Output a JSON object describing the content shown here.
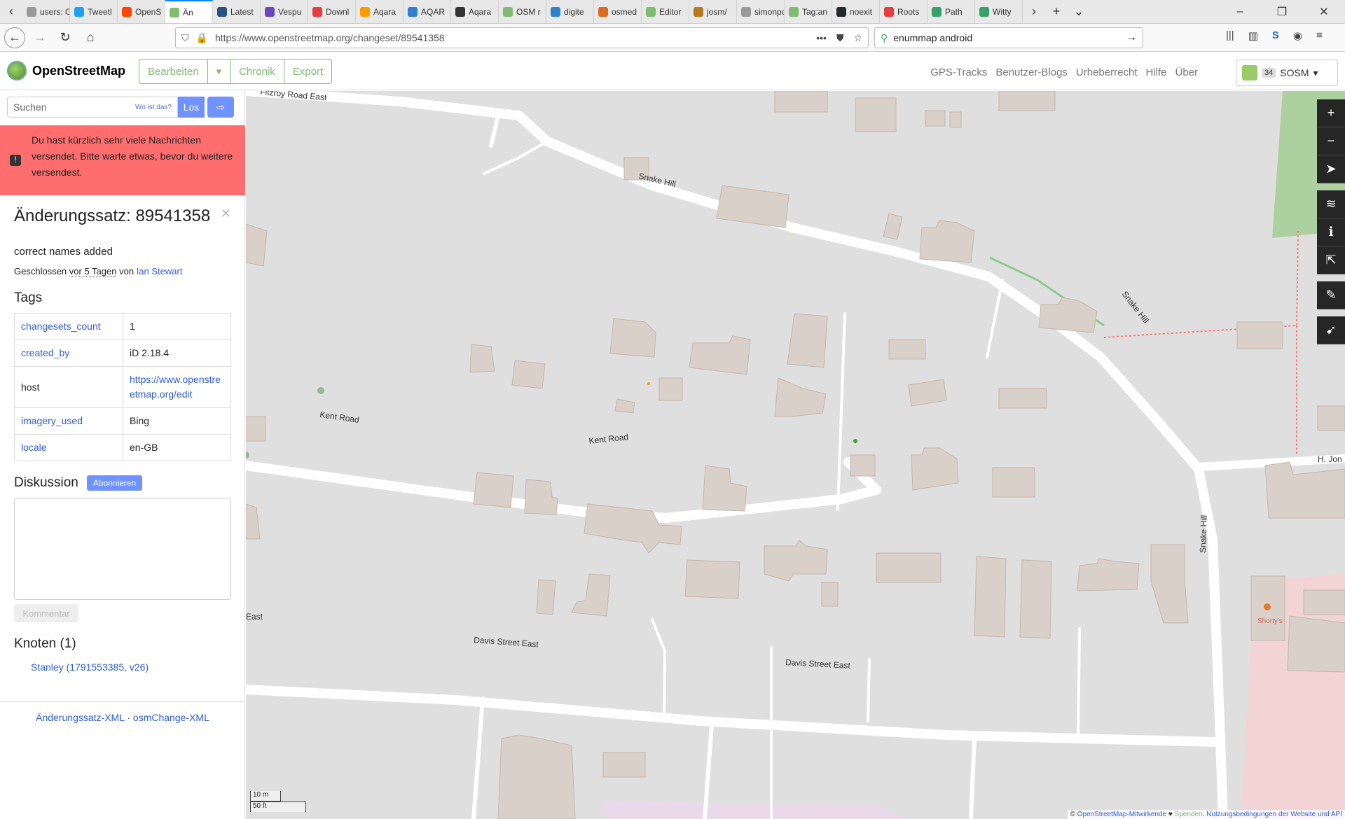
{
  "browser": {
    "tabs": [
      {
        "label": "users: Gern",
        "color": "#999"
      },
      {
        "label": "Tweetl",
        "color": "#1da1f2"
      },
      {
        "label": "OpenS",
        "color": "#ff4500"
      },
      {
        "label": "Än",
        "color": "#7ebc6f"
      },
      {
        "label": "Latest",
        "color": "#2c5282"
      },
      {
        "label": "Vespu",
        "color": "#6b46c1"
      },
      {
        "label": "Downl",
        "color": "#e53e3e"
      },
      {
        "label": "Aqara",
        "color": "#ff9900"
      },
      {
        "label": "AQAR",
        "color": "#3182ce"
      },
      {
        "label": "Aqara",
        "color": "#333"
      },
      {
        "label": "OSM r",
        "color": "#7ebc6f"
      },
      {
        "label": "digite",
        "color": "#3182ce"
      },
      {
        "label": "osmed",
        "color": "#dd6b20"
      },
      {
        "label": "Editor",
        "color": "#7ebc6f"
      },
      {
        "label": "josm/",
        "color": "#b7791f"
      },
      {
        "label": "simonpoo",
        "color": "#999"
      },
      {
        "label": "Tag:an",
        "color": "#7ebc6f"
      },
      {
        "label": "noexit",
        "color": "#24292e"
      },
      {
        "label": "Roots",
        "color": "#e53e3e"
      },
      {
        "label": "Path",
        "color": "#38a169"
      },
      {
        "label": "Witty",
        "color": "#38a169"
      }
    ],
    "url": "https://www.openstreetmap.org/changeset/89541358",
    "search_value": "enummap android"
  },
  "header": {
    "brand": "OpenStreetMap",
    "edit_label": "Bearbeiten",
    "edit_dropdown": "▾",
    "history_label": "Chronik",
    "export_label": "Export",
    "nav": [
      "GPS-Tracks",
      "Benutzer-Blogs",
      "Urheberrecht",
      "Hilfe",
      "Über"
    ],
    "user_count": "34",
    "user_name": "SOSM"
  },
  "search": {
    "placeholder": "Suchen",
    "hint": "Wo ist das?",
    "go_label": "Los"
  },
  "flash": {
    "message": "Du hast kürzlich sehr viele Nachrichten versendet. Bitte warte etwas, bevor du weitere versendest."
  },
  "changeset": {
    "title": "Änderungssatz: 89541358",
    "comment": "correct names added",
    "closed_prefix": "Geschlossen",
    "closed_when": "vor 5 Tagen",
    "by_word": "von",
    "user": "Ian Stewart",
    "tags_heading": "Tags",
    "tags": [
      {
        "key": "changesets_count",
        "value": "1",
        "key_link": true,
        "value_link": false
      },
      {
        "key": "created_by",
        "value": "iD 2.18.4",
        "key_link": true,
        "value_link": false
      },
      {
        "key": "host",
        "value": "https://www.openstreetmap.org/edit",
        "key_link": false,
        "value_link": true
      },
      {
        "key": "imagery_used",
        "value": "Bing",
        "key_link": true,
        "value_link": false
      },
      {
        "key": "locale",
        "value": "en-GB",
        "key_link": true,
        "value_link": false
      }
    ],
    "discussion_heading": "Diskussion",
    "subscribe_label": "Abonnieren",
    "comment_button": "Kommentar",
    "nodes_heading": "Knoten (1)",
    "nodes": [
      "Stanley (1791553385, v26)"
    ],
    "footer_xml": "Änderungssatz-XML",
    "footer_sep": "·",
    "footer_osmchange": "osmChange-XML"
  },
  "map": {
    "road_labels": [
      "Fitzroy Road East",
      "Snake Hill",
      "Snake Hill",
      "Kent Road",
      "Kent Road",
      "Snake Hill",
      "H. Jon",
      "Davis Street East",
      "Davis Street East",
      "East"
    ],
    "poi_label": "Shorty's",
    "scale_m": "10 m",
    "scale_ft": "50 ft",
    "attribution_prefix": "©",
    "attribution_contrib": "OpenStreetMap-Mitwirkende",
    "attribution_heart": "♥",
    "attribution_donate": "Spenden",
    "attribution_terms": "Nutzungsbedingungen der Website und API"
  },
  "colors": {
    "accent": "#7ebc6f",
    "link": "#2f5dd6",
    "button": "#7092ff",
    "flash": "#ff6e6e",
    "building": "#d9d0c9",
    "land": "#e0dfdf"
  }
}
